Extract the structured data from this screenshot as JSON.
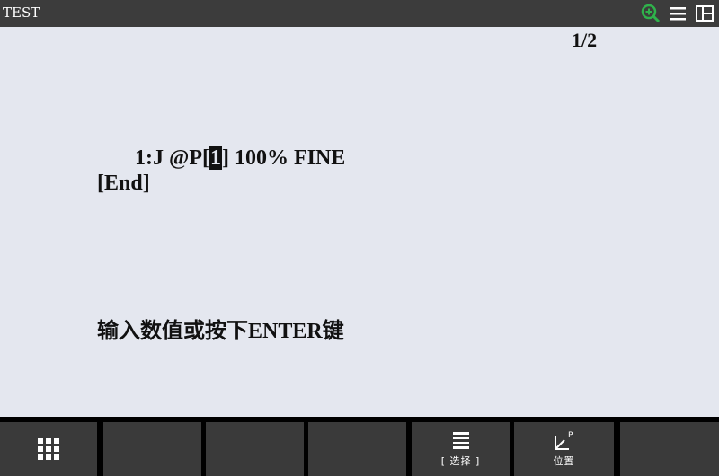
{
  "titlebar": {
    "title": "TEST",
    "icons": [
      "zoom-in-icon",
      "menu-icon",
      "split-view-icon"
    ],
    "accent_color": "#2fb24b"
  },
  "screen": {
    "page_indicator": "1/2",
    "program_lines": [
      {
        "prefix": "1:J ",
        "bracket_open": "@P[",
        "cursor_value": "1",
        "suffix": "] 100% FINE"
      },
      {
        "text": "[End]"
      }
    ],
    "prompt": "输入数值或按下ENTER键"
  },
  "function_keys": [
    {
      "icon": "grid-menu-icon",
      "label": ""
    },
    {
      "label": ""
    },
    {
      "label": ""
    },
    {
      "label": ""
    },
    {
      "icon": "list-select-icon",
      "label": "[ 选择 ]"
    },
    {
      "icon": "position-icon",
      "label": "位置"
    },
    {
      "label": ""
    }
  ]
}
